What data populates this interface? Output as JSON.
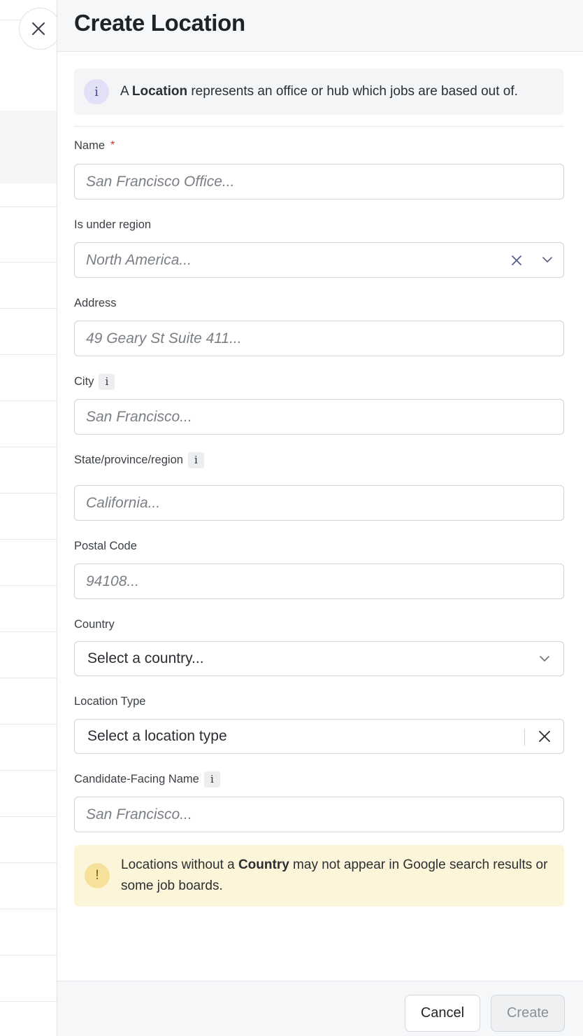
{
  "drawer": {
    "title": "Create Location",
    "info": {
      "prefix": "A ",
      "bold": "Location",
      "suffix": " represents an office or hub which jobs are based out of."
    },
    "fields": {
      "name": {
        "label": "Name",
        "required_mark": "*",
        "placeholder": "San Francisco Office..."
      },
      "region": {
        "label": "Is under region",
        "placeholder": "North America..."
      },
      "address": {
        "label": "Address",
        "placeholder": "49 Geary St Suite 411..."
      },
      "city": {
        "label": "City",
        "tip": "i",
        "placeholder": "San Francisco..."
      },
      "state": {
        "label": "State/province/region",
        "tip": "i",
        "placeholder": "California..."
      },
      "postal": {
        "label": "Postal Code",
        "placeholder": "94108..."
      },
      "country": {
        "label": "Country",
        "value": "Select a country..."
      },
      "location_type": {
        "label": "Location Type",
        "value": "Select a location type"
      },
      "candidate_name": {
        "label": "Candidate-Facing Name",
        "tip": "i",
        "placeholder": "San Francisco..."
      }
    },
    "warning": {
      "icon": "!",
      "prefix": "Locations without a ",
      "bold": "Country",
      "suffix": " may not appear in Google search results or some job boards."
    },
    "footer": {
      "cancel_label": "Cancel",
      "create_label": "Create"
    },
    "info_icon": "i"
  },
  "colors": {
    "header_bg": "#f5f7f9",
    "info_banner_bg": "#f3f5f7",
    "warning_bg": "#fdf5d9",
    "required": "#c0392b"
  }
}
